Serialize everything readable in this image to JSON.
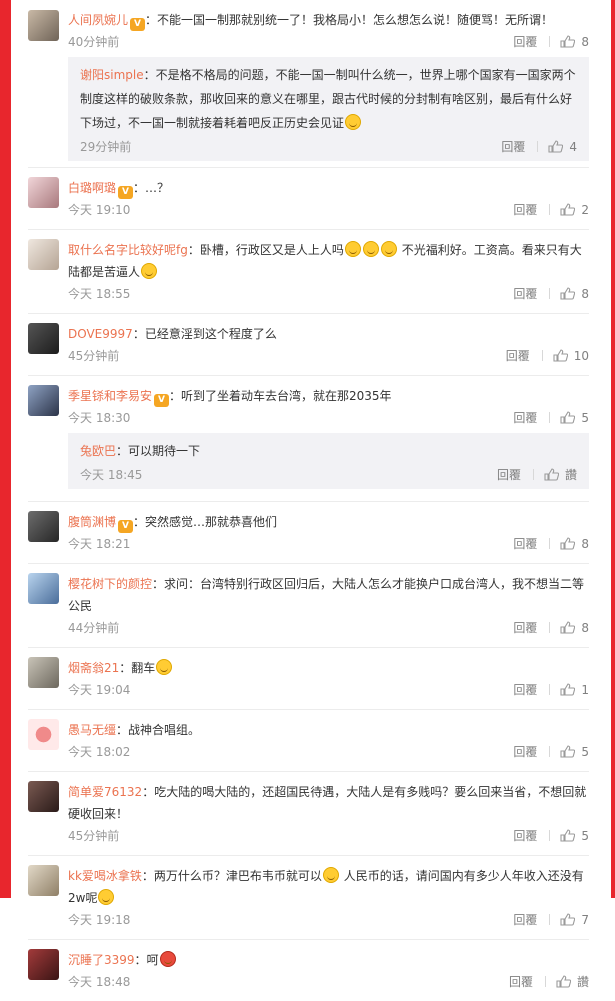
{
  "reply_label": "回覆",
  "comments": [
    {
      "nick": "人间夙婉儿",
      "vip": true,
      "text": "：不能一国一制那就别统一了！我格局小！怎么想怎么说！随便骂！无所谓！",
      "time": "40分钟前",
      "likes": "8",
      "sub": {
        "nick": "谢阳simple",
        "text": "：不是格不格局的问题，不能一国一制叫什么统一，世界上哪个国家有一国家两个制度这样的破败条款，那收回来的意义在哪里，跟古代时候的分封制有啥区别，最后有什么好下场过，不一国一制就接着耗着吧反正历史会见证",
        "time": "29分钟前",
        "likes": "4"
      }
    },
    {
      "nick": "白璐啊璐",
      "vip": true,
      "text": "：…？",
      "time": "今天 19:10",
      "likes": "2"
    },
    {
      "nick": "取什么名字比较好呢fg",
      "vip": false,
      "text": "：卧槽，行政区又是人上人吗",
      "text2": "不光福利好。工资高。看来只有大陆都是苦逼人",
      "time": "今天 18:55",
      "likes": "8"
    },
    {
      "nick": "DOVE9997",
      "vip": false,
      "text": "：已经意淫到这个程度了么",
      "time": "45分钟前",
      "likes": "10"
    },
    {
      "nick": "季星铩和李易安",
      "vip": true,
      "text": "：听到了坐着动车去台湾，就在那2035年",
      "time": "今天 18:30",
      "likes": "5",
      "sub": {
        "nick": "兔欧巴",
        "text": "：可以期待一下",
        "time": "今天 18:45",
        "likes": "讚"
      }
    },
    {
      "nick": "腹筒渊博",
      "vip": true,
      "text": "：突然感觉…那就恭喜他们",
      "time": "今天 18:21",
      "likes": "8"
    },
    {
      "nick": "樱花树下的颜控",
      "vip": false,
      "text": "：求问：台湾特别行政区回归后，大陆人怎么才能换户口成台湾人，我不想当二等公民",
      "time": "44分钟前",
      "likes": "8"
    },
    {
      "nick": "烟斋翁21",
      "vip": false,
      "text": "：翻车",
      "time": "今天 19:04",
      "likes": "1"
    },
    {
      "nick": "愚马无缰",
      "vip": false,
      "text": "：战神合唱组。",
      "time": "今天 18:02",
      "likes": "5"
    },
    {
      "nick": "简单爱76132",
      "vip": false,
      "text": "：吃大陆的喝大陆的，还超国民待遇，大陆人是有多贱吗？要么回来当省，不想回就硬收回来！",
      "time": "45分钟前",
      "likes": "5"
    },
    {
      "nick": "kk爱喝冰拿铁",
      "vip": false,
      "text": "：两万什么币？津巴布韦币就可以",
      "text2": "人民币的话，请问国内有多少人年收入还没有2w呢",
      "time": "今天 19:18",
      "likes": "7"
    },
    {
      "nick": "沉睡了3399",
      "vip": false,
      "text": "：呵",
      "time": "今天 18:48",
      "likes": "讚"
    }
  ]
}
